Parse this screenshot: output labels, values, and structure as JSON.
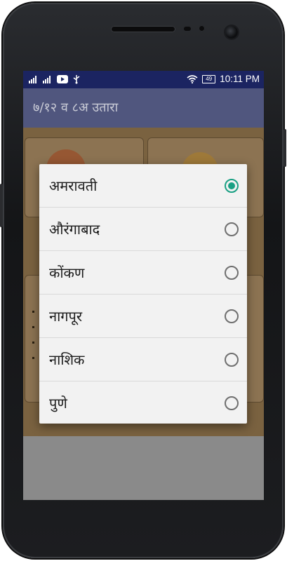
{
  "status_bar": {
    "time": "10:11 PM",
    "battery_level": "49",
    "icons": [
      "signal-icon",
      "signal-icon",
      "youtube-icon",
      "usb-icon",
      "wifi-icon",
      "battery-icon"
    ]
  },
  "app_bar": {
    "title": "७/१२ व ८अ उतारा"
  },
  "dialog": {
    "options": [
      {
        "label": "अमरावती",
        "selected": true
      },
      {
        "label": "औरंगाबाद",
        "selected": false
      },
      {
        "label": "कोंकण",
        "selected": false
      },
      {
        "label": "नागपूर",
        "selected": false
      },
      {
        "label": "नाशिक",
        "selected": false
      },
      {
        "label": "पुणे",
        "selected": false
      }
    ]
  },
  "colors": {
    "status_bar": "#1b2461",
    "radio_selected": "#1aa084",
    "dialog_bg": "#f2f2f2"
  }
}
